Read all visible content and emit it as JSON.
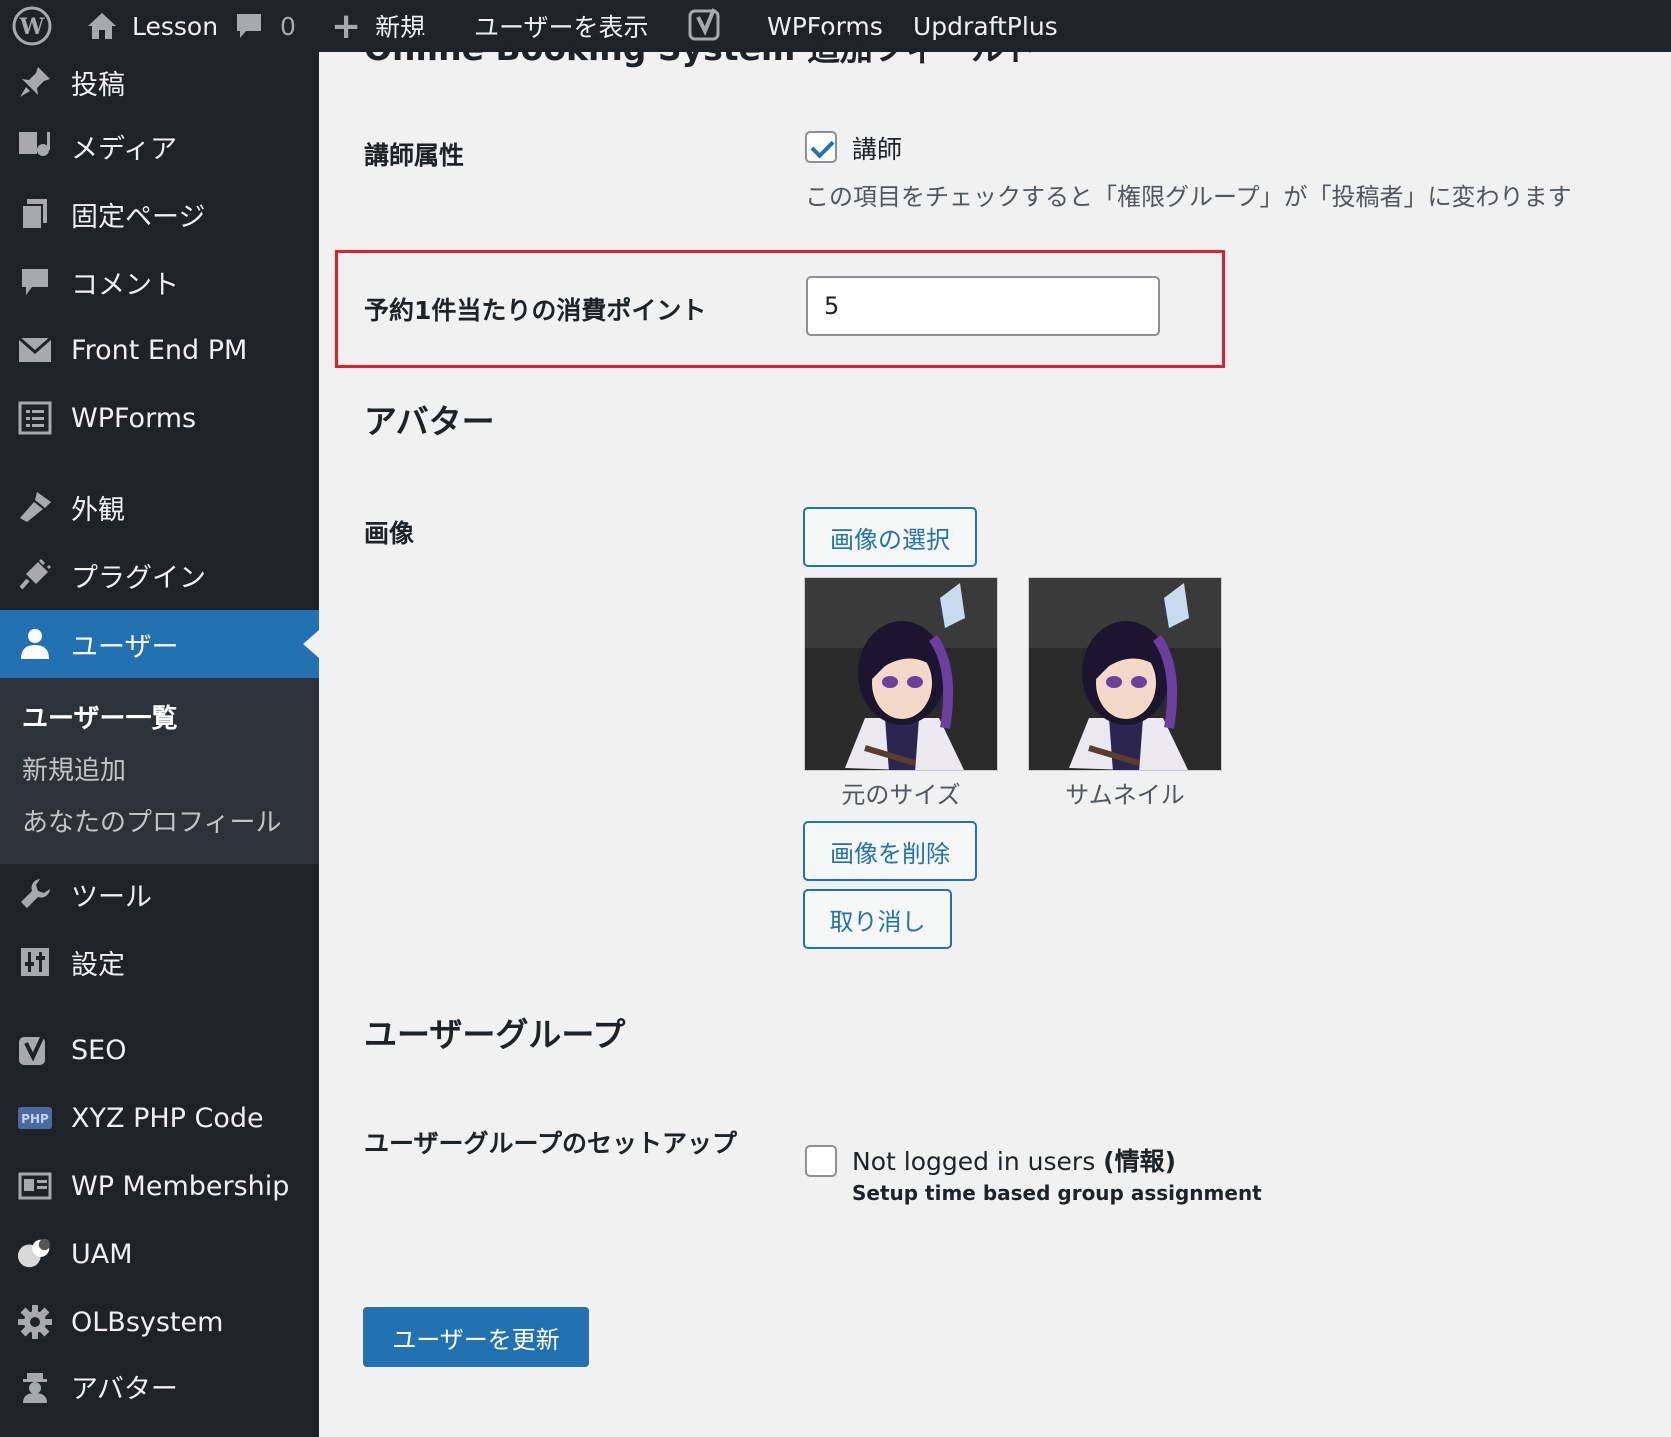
{
  "adminbar": {
    "site_name": "Lesson",
    "comments_count": "0",
    "new_label": "新規",
    "view_user": "ユーザーを表示",
    "wpforms": "WPForms",
    "updraftplus": "UpdraftPlus"
  },
  "sidebar": {
    "items": [
      {
        "label": "投稿",
        "icon": "pin-icon"
      },
      {
        "label": "メディア",
        "icon": "media-icon"
      },
      {
        "label": "固定ページ",
        "icon": "page-icon"
      },
      {
        "label": "コメント",
        "icon": "comment-icon"
      },
      {
        "label": "Front End PM",
        "icon": "mail-icon"
      },
      {
        "label": "WPForms",
        "icon": "form-icon"
      },
      {
        "label": "外観",
        "icon": "brush-icon"
      },
      {
        "label": "プラグイン",
        "icon": "plugin-icon"
      },
      {
        "label": "ユーザー",
        "icon": "user-icon"
      },
      {
        "label": "ツール",
        "icon": "wrench-icon"
      },
      {
        "label": "設定",
        "icon": "settings-icon"
      },
      {
        "label": "SEO",
        "icon": "yoast-icon"
      },
      {
        "label": "XYZ PHP Code",
        "icon": "php-icon"
      },
      {
        "label": "WP Membership",
        "icon": "id-card-icon"
      },
      {
        "label": "UAM",
        "icon": "uam-icon"
      },
      {
        "label": "OLBsystem",
        "icon": "gear-icon"
      },
      {
        "label": "アバター",
        "icon": "avatar-icon"
      }
    ],
    "submenu": {
      "current": "ユーザー一覧",
      "add_new": "新規追加",
      "profile": "あなたのプロフィール"
    }
  },
  "main": {
    "section_cut_title": "Online Booking System 追加フィールド",
    "instructor_label": "講師属性",
    "instructor_checkbox_label": "講師",
    "instructor_checked": true,
    "instructor_help": "この項目をチェックすると「権限グループ」が「投稿者」に変わります",
    "points_label": "予約1件当たりの消費ポイント",
    "points_value": "5",
    "avatar_heading": "アバター",
    "image_label": "画像",
    "select_image_button": "画像の選択",
    "caption_original": "元のサイズ",
    "caption_thumbnail": "サムネイル",
    "delete_image_button": "画像を削除",
    "cancel_button": "取り消し",
    "user_group_heading": "ユーザーグループ",
    "user_group_setup_label": "ユーザーグループのセットアップ",
    "not_logged_in_label": "Not logged in users",
    "info_label": "(情報)",
    "not_logged_in_checked": false,
    "time_based_label": "Setup time based group assignment",
    "update_button": "ユーザーを更新"
  },
  "colors": {
    "accent": "#2271b1",
    "highlight_border": "#e0202e",
    "sidebar_bg": "#1d2327"
  }
}
